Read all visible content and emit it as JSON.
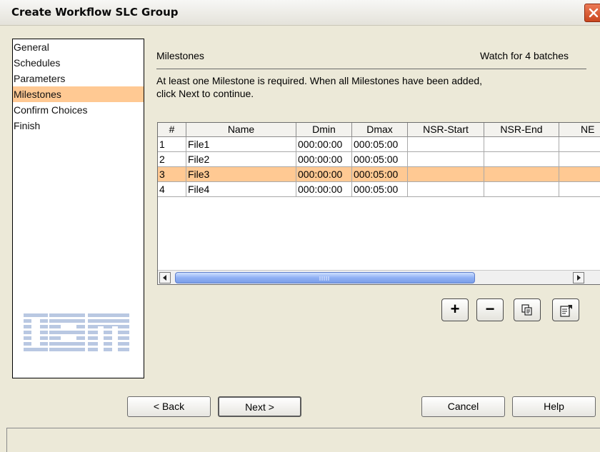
{
  "window": {
    "title": "Create Workflow SLC Group",
    "close_icon": "close-icon"
  },
  "nav": {
    "items": [
      {
        "label": "General"
      },
      {
        "label": "Schedules"
      },
      {
        "label": "Parameters"
      },
      {
        "label": "Milestones",
        "selected": true
      },
      {
        "label": "Confirm Choices"
      },
      {
        "label": "Finish"
      }
    ],
    "logo": "IBM"
  },
  "content": {
    "section_title": "Milestones",
    "watch_text": "Watch for 4 batches",
    "instruction_line1": "At least one Milestone is required. When all Milestones have been added,",
    "instruction_line2": "click Next to continue."
  },
  "table": {
    "headers": [
      "#",
      "Name",
      "Dmin",
      "Dmax",
      "NSR-Start",
      "NSR-End",
      "NE"
    ],
    "rows": [
      [
        "1",
        "File1",
        "000:00:00",
        "000:05:00",
        "",
        "",
        ""
      ],
      [
        "2",
        "File2",
        "000:00:00",
        "000:05:00",
        "",
        "",
        ""
      ],
      [
        "3",
        "File3",
        "000:00:00",
        "000:05:00",
        "",
        "",
        ""
      ],
      [
        "4",
        "File4",
        "000:00:00",
        "000:05:00",
        "",
        "",
        ""
      ]
    ],
    "selected_row": 3
  },
  "toolbar": {
    "add_label": "+",
    "remove_label": "−",
    "copy_icon": "copy-icon",
    "properties_icon": "properties-icon"
  },
  "buttons": {
    "back": "< Back",
    "next": "Next >",
    "cancel": "Cancel",
    "help": "Help"
  },
  "colors": {
    "selection": "#ffc993",
    "window_bg": "#ece9d8"
  }
}
